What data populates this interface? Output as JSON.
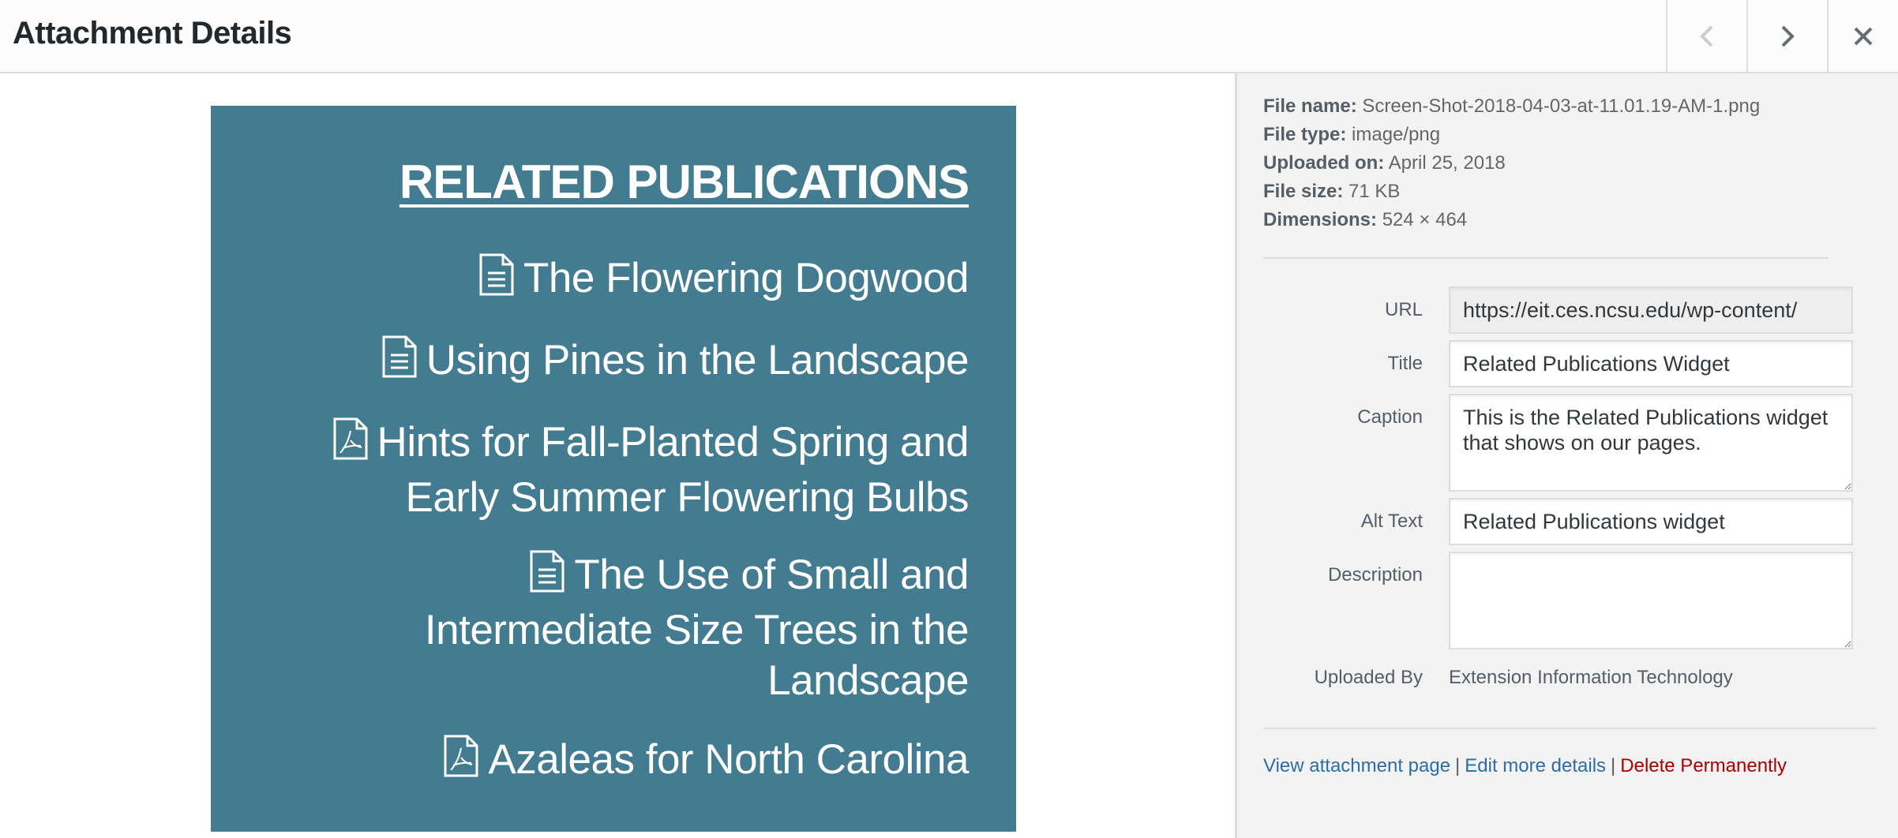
{
  "header": {
    "title": "Attachment Details",
    "prev_label": "Previous",
    "next_label": "Next",
    "close_label": "Close",
    "prev_icon": "chevron-left-icon",
    "next_icon": "chevron-right-icon",
    "close_icon": "close-icon",
    "prev_disabled": true
  },
  "preview": {
    "background_color": "#437c90",
    "title": "RELATED PUBLICATIONS",
    "publications": [
      {
        "icon": "document-icon",
        "lines": [
          "The Flowering Dogwood"
        ]
      },
      {
        "icon": "document-icon",
        "lines": [
          "Using Pines in the Landscape"
        ]
      },
      {
        "icon": "pdf-icon",
        "lines": [
          "Hints for Fall-Planted Spring and",
          "Early Summer Flowering Bulbs"
        ]
      },
      {
        "icon": "document-icon",
        "lines": [
          "The Use of Small and",
          "Intermediate Size Trees in the",
          "Landscape"
        ]
      },
      {
        "icon": "pdf-icon",
        "lines": [
          "Azaleas for North Carolina"
        ]
      }
    ]
  },
  "details": {
    "file_name": {
      "label": "File name:",
      "value": "Screen-Shot-2018-04-03-at-11.01.19-AM-1.png"
    },
    "file_type": {
      "label": "File type:",
      "value": "image/png"
    },
    "uploaded_on": {
      "label": "Uploaded on:",
      "value": "April 25, 2018"
    },
    "file_size": {
      "label": "File size:",
      "value": "71 KB"
    },
    "dimensions": {
      "label": "Dimensions:",
      "value": "524 × 464"
    }
  },
  "fields": {
    "url": {
      "label": "URL",
      "value": "https://eit.ces.ncsu.edu/wp-content/"
    },
    "title": {
      "label": "Title",
      "value": "Related Publications Widget"
    },
    "caption": {
      "label": "Caption",
      "value": "This is the Related Publications widget that shows on our pages."
    },
    "alt_text": {
      "label": "Alt Text",
      "value": "Related Publications widget"
    },
    "description": {
      "label": "Description",
      "value": ""
    },
    "uploaded_by": {
      "label": "Uploaded By",
      "value": "Extension Information Technology"
    }
  },
  "actions": {
    "view": "View attachment page",
    "edit": "Edit more details",
    "delete": "Delete Permanently",
    "separator": "|",
    "link_color": "#2e6da4",
    "delete_color": "#a00000"
  }
}
